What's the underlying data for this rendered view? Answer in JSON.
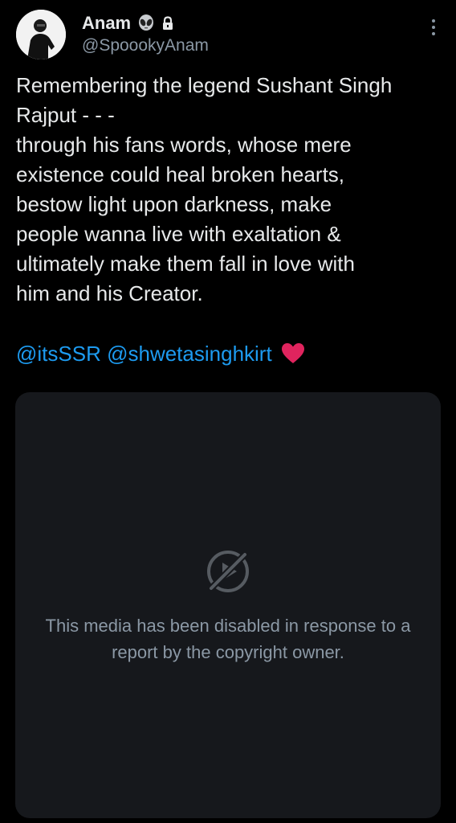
{
  "author": {
    "display_name": "Anam",
    "handle": "@SpoookyAnam",
    "badge_icons": [
      "alien-icon",
      "lock-icon"
    ]
  },
  "tweet": {
    "text": "Remembering the legend Sushant Singh\nRajput - - -\nthrough his fans words, whose mere\nexistence could heal broken hearts,\nbestow light upon darkness, make\npeople wanna live with exaltation &\nultimately make them fall in love with\nhim and his Creator.",
    "mentions": [
      "@itsSSR",
      "@shwetasinghkirt"
    ],
    "emoji": "heart-icon"
  },
  "media": {
    "message": "This media has been disabled in response to a report by the copyright owner.",
    "icon": "disabled-video-icon"
  },
  "colors": {
    "background": "#000000",
    "text": "#e7e9ea",
    "secondary": "#8b98a5",
    "link": "#1d9bf0",
    "card": "#16181c",
    "heart": "#e0245e"
  }
}
